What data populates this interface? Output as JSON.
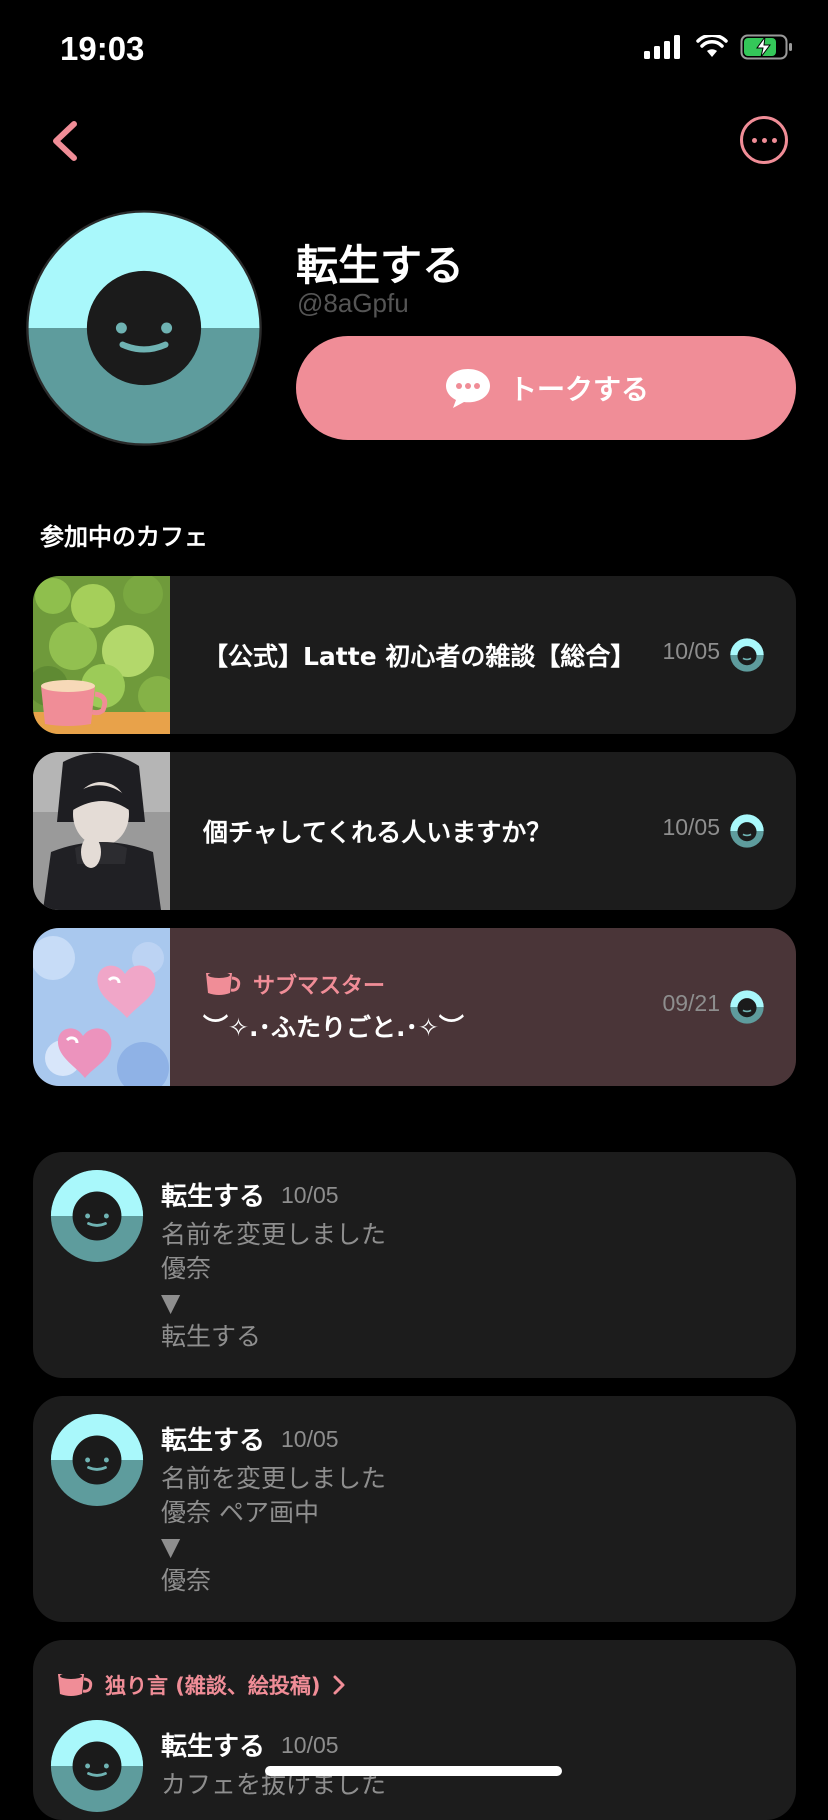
{
  "status_bar": {
    "time": "19:03"
  },
  "profile": {
    "name": "転生する",
    "handle": "@8aGpfu",
    "talk_button": "トークする"
  },
  "cafes_section": {
    "title": "参加中のカフェ",
    "items": [
      {
        "title": "【公式】Latte 初心者の雑談【総合】",
        "date": "10/05"
      },
      {
        "title": "個チャしてくれる人いますか？",
        "date": "10/05"
      },
      {
        "role": "サブマスター",
        "title": "︶✧.･ふたりごと.･✧︶",
        "date": "09/21"
      }
    ]
  },
  "activity": [
    {
      "name": "転生する",
      "date": "10/05",
      "lines": [
        "名前を変更しました",
        "優奈",
        "▼",
        "転生する"
      ]
    },
    {
      "name": "転生する",
      "date": "10/05",
      "lines": [
        "名前を変更しました",
        "優奈 ペア画中",
        "▼",
        "優奈"
      ]
    },
    {
      "channel": "独り言 (雑談、絵投稿)",
      "name": "転生する",
      "date": "10/05",
      "lines": [
        "カフェを抜けました"
      ]
    }
  ],
  "colors": {
    "accent": "#f08d97",
    "avatar_top": "#a9f8fb",
    "avatar_bottom": "#5e9c9d",
    "card": "#1c1c1c",
    "card_sub": "#4a3538"
  },
  "icons": [
    "back-chevron-icon",
    "more-options-icon",
    "chat-bubble-icon",
    "cup-icon",
    "signal-icon",
    "wifi-icon",
    "battery-icon"
  ]
}
